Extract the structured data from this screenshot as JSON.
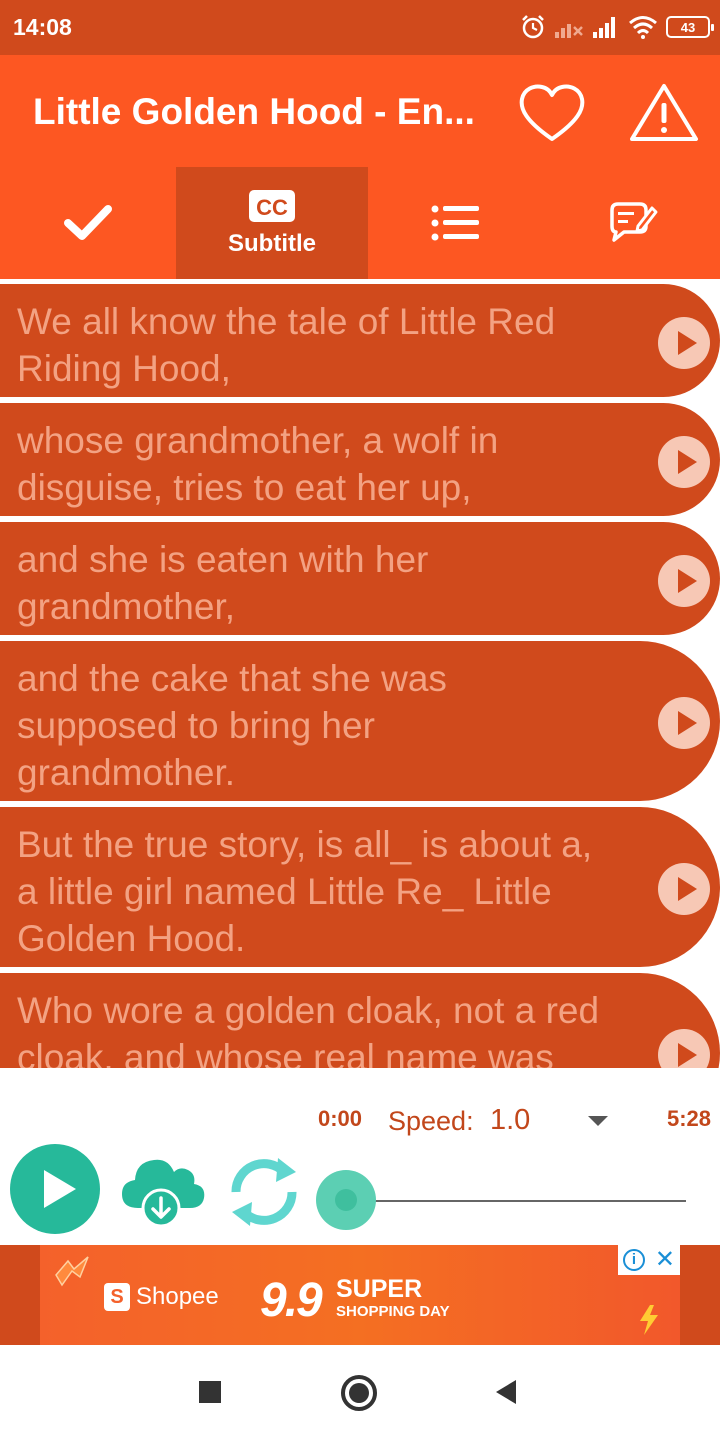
{
  "status_bar": {
    "time": "14:08",
    "battery": "43",
    "icons": [
      "alarm-icon",
      "signal-no-data-icon",
      "signal-icon",
      "wifi-icon",
      "battery-icon"
    ]
  },
  "app_bar": {
    "title": "Little Golden Hood - En...",
    "actions": [
      "heart-icon",
      "warning-icon"
    ]
  },
  "tabs": [
    {
      "icon": "checkmark-icon",
      "label": ""
    },
    {
      "icon": "cc-icon",
      "label": "Subtitle",
      "active": true
    },
    {
      "icon": "list-icon",
      "label": ""
    },
    {
      "icon": "edit-comment-icon",
      "label": ""
    }
  ],
  "subtitles": [
    {
      "line1": "We all know the tale of Little Red",
      "line2": "Riding Hood,",
      "line3": ""
    },
    {
      "line1": "whose grandmother, a wolf in",
      "line2": "disguise, tries to eat her up,",
      "line3": ""
    },
    {
      "line1": "and she is eaten with her",
      "line2": "grandmother,",
      "line3": ""
    },
    {
      "line1": "and the cake that she was",
      "line2": "supposed to bring her",
      "line3": "grandmother."
    },
    {
      "line1": "But the true story, is all_ is about a,",
      "line2": "a little girl named Little Re_ Little",
      "line3": "Golden Hood."
    },
    {
      "line1": "Who wore a golden cloak, not a red",
      "line2": "cloak, and whose real name was",
      "line3": ""
    }
  ],
  "player": {
    "current_time": "0:00",
    "speed_label": "Speed:",
    "speed_value": "1.0",
    "total_time": "5:28",
    "progress": 0
  },
  "ad": {
    "brand": "Shopee",
    "sale": "9.9",
    "headline": "SUPER",
    "subline": "SHOPPING DAY",
    "info": "i",
    "close": "✕"
  },
  "colors": {
    "primary": "#fd5722",
    "primary_dark": "#d04a1c",
    "accent": "#26b99a",
    "subtitle_text": "#f3a283"
  }
}
